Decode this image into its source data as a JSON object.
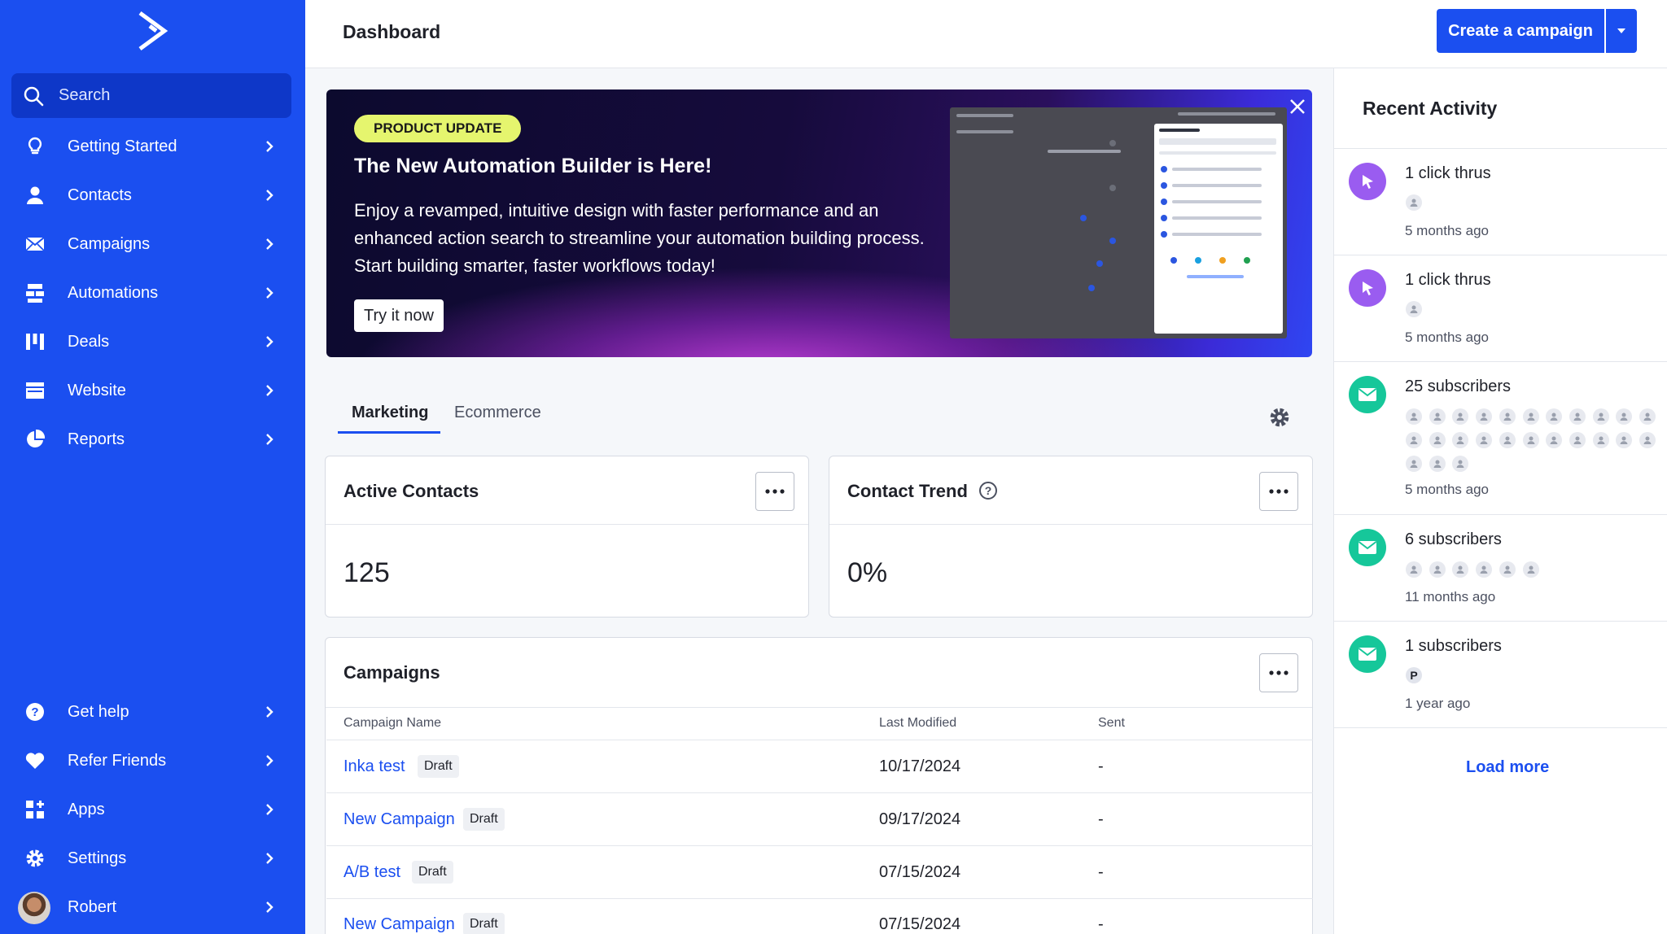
{
  "colors": {
    "brand": "#1b4ff0",
    "sidebar": "#1b4ff0",
    "badge": "#e5f56e",
    "click_icon": "#9a5cf0",
    "mail_icon": "#16c79a"
  },
  "sidebar": {
    "search_placeholder": "Search",
    "items": [
      {
        "label": "Getting Started",
        "icon": "lightbulb-icon"
      },
      {
        "label": "Contacts",
        "icon": "person-icon"
      },
      {
        "label": "Campaigns",
        "icon": "envelope-icon"
      },
      {
        "label": "Automations",
        "icon": "automation-icon"
      },
      {
        "label": "Deals",
        "icon": "deals-board-icon"
      },
      {
        "label": "Website",
        "icon": "website-icon"
      },
      {
        "label": "Reports",
        "icon": "pie-chart-icon"
      }
    ],
    "bottom_items": [
      {
        "label": "Get help",
        "icon": "help-circle-icon"
      },
      {
        "label": "Refer Friends",
        "icon": "heart-icon"
      },
      {
        "label": "Apps",
        "icon": "apps-grid-icon"
      },
      {
        "label": "Settings",
        "icon": "gear-icon"
      },
      {
        "label": "Robert",
        "icon": "avatar"
      }
    ]
  },
  "header": {
    "title": "Dashboard",
    "create_label": "Create a campaign"
  },
  "banner": {
    "badge": "PRODUCT UPDATE",
    "title": "The New Automation Builder is Here!",
    "body": "Enjoy a revamped, intuitive design with faster performance and an enhanced action search to streamline your automation building process. Start building smarter, faster workflows today!",
    "cta": "Try it now"
  },
  "tabs": [
    {
      "label": "Marketing",
      "active": true
    },
    {
      "label": "Ecommerce",
      "active": false
    }
  ],
  "cards": {
    "active_contacts": {
      "title": "Active Contacts",
      "value": "125"
    },
    "contact_trend": {
      "title": "Contact Trend",
      "value": "0%"
    }
  },
  "campaigns": {
    "title": "Campaigns",
    "columns": [
      "Campaign Name",
      "Last Modified",
      "Sent"
    ],
    "rows": [
      {
        "name": "Inka test",
        "status": "Draft",
        "modified": "10/17/2024",
        "sent": "-"
      },
      {
        "name": "New Campaign",
        "status": "Draft",
        "modified": "09/17/2024",
        "sent": "-"
      },
      {
        "name": "A/B test",
        "status": "Draft",
        "modified": "07/15/2024",
        "sent": "-"
      },
      {
        "name": "New Campaign",
        "status": "Draft",
        "modified": "07/15/2024",
        "sent": "-"
      }
    ]
  },
  "activity": {
    "title": "Recent Activity",
    "items": [
      {
        "type": "click",
        "label": "1 click thrus",
        "time": "5 months ago",
        "people": 1
      },
      {
        "type": "click",
        "label": "1 click thrus",
        "time": "5 months ago",
        "people": 1
      },
      {
        "type": "mail",
        "label": "25 subscribers",
        "time": "5 months ago",
        "people": 25
      },
      {
        "type": "mail",
        "label": "6 subscribers",
        "time": "11 months ago",
        "people": 6
      },
      {
        "type": "mail",
        "label": "1 subscribers",
        "time": "1 year ago",
        "people": 1,
        "initial": "P"
      }
    ],
    "load_more": "Load more"
  }
}
